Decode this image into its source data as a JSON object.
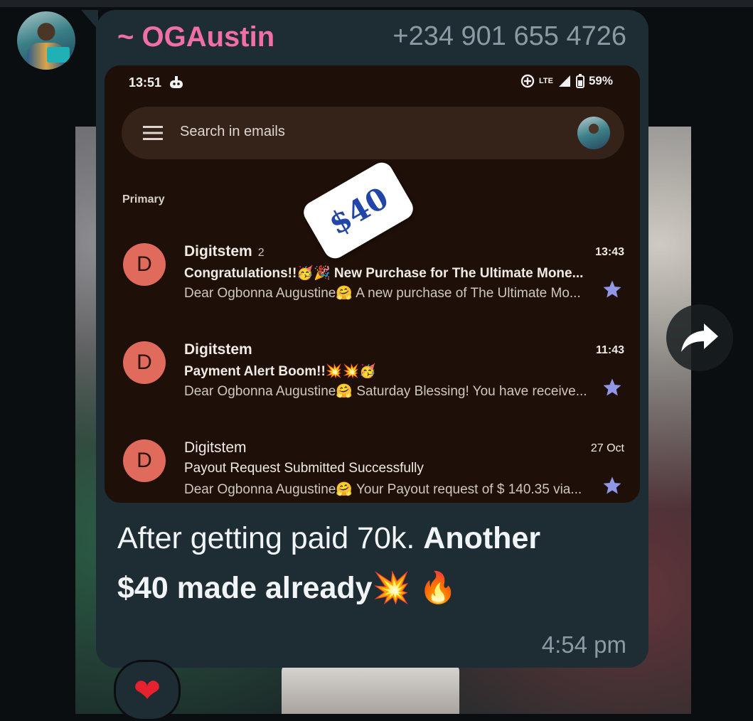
{
  "chat": {
    "sender_name": "~ OGAustin",
    "sender_phone": "+234 901 655 4726",
    "message_text_regular": "After getting paid 70k.  ",
    "message_text_bold_1": "Another",
    "message_text_bold_2": "$40 made already",
    "message_emoji": "💥 🔥",
    "message_time": "4:54 pm",
    "reaction_emoji": "❤"
  },
  "screenshot": {
    "status_time": "13:51",
    "network": "LTE",
    "battery": "59%",
    "search_placeholder": "Search in emails",
    "section_label": "Primary",
    "sticker_text": "$40",
    "emails": [
      {
        "avatar_letter": "D",
        "sender": "Digitstem",
        "count": "2",
        "time": "13:43",
        "subject": "Congratulations!!🥳🎉 New Purchase for The Ultimate Mone...",
        "preview": "Dear Ogbonna Augustine🤗 A new purchase of The Ultimate Mo...",
        "unread": true
      },
      {
        "avatar_letter": "D",
        "sender": "Digitstem",
        "count": "",
        "time": "11:43",
        "subject": "Payment Alert Boom!!💥💥🥳",
        "preview": "Dear Ogbonna Augustine🤗 Saturday Blessing! You have receive...",
        "unread": true
      },
      {
        "avatar_letter": "D",
        "sender": "Digitstem",
        "count": "",
        "time": "27 Oct",
        "subject": "Payout Request Submitted Successfully",
        "preview": "Dear Ogbonna Augustine🤗 Your Payout request of $ 140.35 via...",
        "unread": false
      }
    ]
  },
  "colors": {
    "sender_name": "#f06fa4",
    "bubble": "#1e2c33",
    "star": "#8f97e6",
    "email_avatar": "#e06a5c"
  }
}
